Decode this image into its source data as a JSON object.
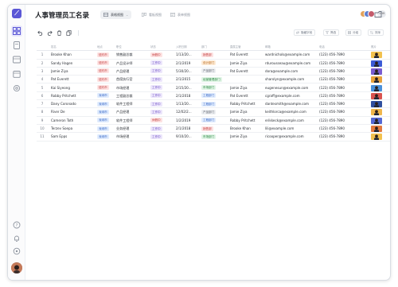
{
  "app": {
    "title": "人事管理员工名录",
    "tabs": [
      {
        "label": "表格视图",
        "active": true
      },
      {
        "label": "看板视图",
        "active": false
      },
      {
        "label": "表单视图",
        "active": false
      }
    ],
    "collaborators_more": "+99",
    "accent": "#5b57d6"
  },
  "toolbar": {
    "chips": [
      {
        "label": "隐藏字段",
        "icon": "eye-off-icon"
      },
      {
        "label": "筛选",
        "icon": "filter-icon"
      },
      {
        "label": "分组",
        "icon": "group-icon"
      },
      {
        "label": "排序",
        "icon": "sort-icon"
      }
    ]
  },
  "table": {
    "columns": [
      "姓名",
      "地点",
      "职位",
      "状态",
      "入职日期",
      "部门",
      "直属主管",
      "邮箱",
      "电话",
      "照片"
    ],
    "rows": [
      {
        "num": "1",
        "name": "Brooke Khan",
        "location": "纽约市",
        "title": "销售副总裁",
        "status": "休假中",
        "date": "1/13/20...",
        "dept": "销售部",
        "manager": "Pat Everett",
        "email": "wardnichols@example.com",
        "phone": "(123) 456-7890"
      },
      {
        "num": "2",
        "name": "Sandy Hagen",
        "location": "纽约市",
        "title": "产品设计师",
        "status": "工作中",
        "date": "2/1/2019",
        "dept": "设计部门",
        "manager": "Jamie Ziya",
        "email": "rdurousseau@example.com",
        "phone": "(123) 456-7890"
      },
      {
        "num": "3",
        "name": "Jamie Ziya",
        "location": "纽约市",
        "title": "产品经理",
        "status": "工作中",
        "date": "5/30/20...",
        "dept": "产品部门",
        "manager": "Pat Everett",
        "email": "dora@example.com",
        "phone": "(123) 456-7890"
      },
      {
        "num": "4",
        "name": "Pat Everett",
        "location": "纽约市",
        "title": "首席执行官",
        "status": "工作中",
        "date": "2/1/2015",
        "dept": "经营管理部门",
        "manager": "",
        "email": "sharolyn@example.com",
        "phone": "(123) 456-7890"
      },
      {
        "num": "5",
        "name": "Kai Siyeong",
        "location": "纽约市",
        "title": "市场经理",
        "status": "工作中",
        "date": "2/15/20...",
        "dept": "市场部门",
        "manager": "Jamie Ziya",
        "email": "eugenesun@example.com",
        "phone": "(123) 456-7890"
      },
      {
        "num": "6",
        "name": "Robby Pritchett",
        "location": "深圳市",
        "title": "工程副总裁",
        "status": "工作中",
        "date": "2/1/2018",
        "dept": "工程部门",
        "manager": "Pat Everett",
        "email": "cgraff@example.com",
        "phone": "(123) 456-7890"
      },
      {
        "num": "7",
        "name": "Dany Coronado",
        "location": "深圳市",
        "title": "软件工程师",
        "status": "工作中",
        "date": "1/13/20...",
        "dept": "工程部门",
        "manager": "Robby Pritchett",
        "email": "dantesmith@example.com",
        "phone": "(123) 456-7890"
      },
      {
        "num": "8",
        "name": "River De",
        "location": "深圳市",
        "title": "产品经理",
        "status": "工作中",
        "date": "12/02/2...",
        "dept": "产品部门",
        "manager": "Jamie Ziya",
        "email": "keithlorca@example.com",
        "phone": "(123) 456-7890"
      },
      {
        "num": "9",
        "name": "Cameron Toth",
        "location": "深圳市",
        "title": "软件工程师",
        "status": "休假中",
        "date": "1/2/2019",
        "dept": "工程部门",
        "manager": "Robby Pritchett",
        "email": "erikkeck@example.com",
        "phone": "(123) 456-7890"
      },
      {
        "num": "10",
        "name": "Terzev Soepa",
        "location": "深圳市",
        "title": "业务经理",
        "status": "工作中",
        "date": "2/1/2018",
        "dept": "销售部",
        "manager": "Brooke Khan",
        "email": "lili@example.com",
        "phone": "(123) 456-7890"
      },
      {
        "num": "11",
        "name": "Sam Epps",
        "location": "深圳市",
        "title": "市场经理",
        "status": "工作中",
        "date": "9/10/20...",
        "dept": "市场部门",
        "manager": "Jamie Ziya",
        "email": "ricooper@example.com",
        "phone": "(123) 456-7890"
      }
    ]
  }
}
